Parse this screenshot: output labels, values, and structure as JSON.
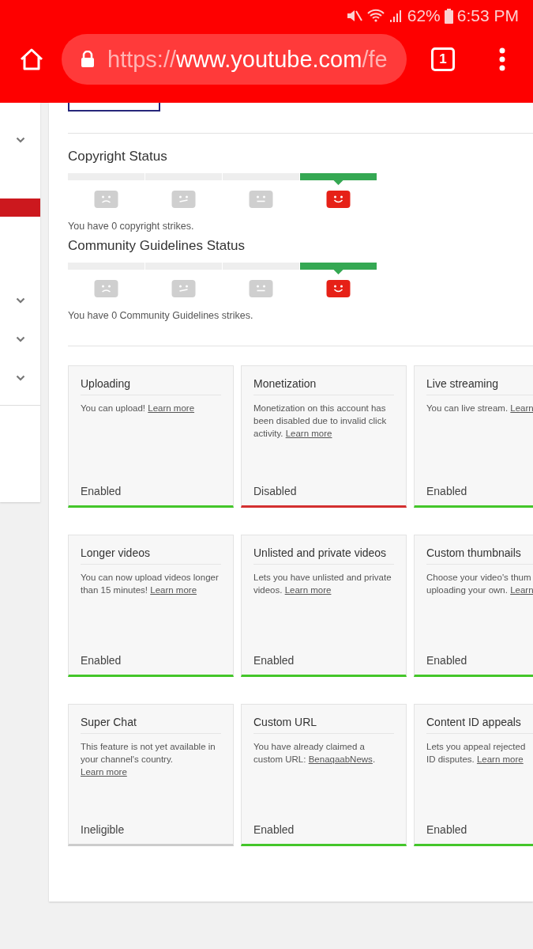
{
  "status_bar": {
    "battery": "62%",
    "time": "6:53 PM"
  },
  "browser": {
    "url_scheme": "https://",
    "url_host": "www.youtube.com",
    "url_path": "/fe",
    "tab_count": "1"
  },
  "sidebar": {
    "items": [
      {
        "expandable": true,
        "selected": false
      },
      {
        "expandable": false,
        "selected": true
      },
      {
        "expandable": true,
        "selected": false
      },
      {
        "expandable": true,
        "selected": false
      },
      {
        "expandable": true,
        "selected": false
      }
    ]
  },
  "statuses": [
    {
      "title": "Copyright Status",
      "levels": [
        {
          "kind": "sad",
          "selected": false
        },
        {
          "kind": "unsure",
          "selected": false
        },
        {
          "kind": "neutral",
          "selected": false
        },
        {
          "kind": "happy",
          "selected": true
        }
      ],
      "message": "You have 0 copyright strikes."
    },
    {
      "title": "Community Guidelines Status",
      "levels": [
        {
          "kind": "sad",
          "selected": false
        },
        {
          "kind": "unsure",
          "selected": false
        },
        {
          "kind": "neutral",
          "selected": false
        },
        {
          "kind": "happy",
          "selected": true
        }
      ],
      "message": "You have 0 Community Guidelines strikes."
    }
  ],
  "features": [
    {
      "title": "Uploading",
      "text": "You can upload! ",
      "link": "Learn more",
      "status": "Enabled",
      "kind": "enabled"
    },
    {
      "title": "Monetization",
      "text": "Monetization on this account has been disabled due to invalid click activity. ",
      "link": "Learn more",
      "status": "Disabled",
      "kind": "disabled"
    },
    {
      "title": "Live streaming",
      "text": "You can live stream. ",
      "link": "Learn",
      "status": "Enabled",
      "kind": "enabled"
    },
    {
      "title": "Longer videos",
      "text": "You can now upload videos longer than 15 minutes! ",
      "link": "Learn more",
      "status": "Enabled",
      "kind": "enabled"
    },
    {
      "title": "Unlisted and private videos",
      "text": "Lets you have unlisted and private videos. ",
      "link": "Learn more",
      "status": "Enabled",
      "kind": "enabled"
    },
    {
      "title": "Custom thumbnails",
      "text": "Choose your video's thum\nuploading your own. ",
      "link": "Learn",
      "status": "Enabled",
      "kind": "enabled"
    },
    {
      "title": "Super Chat",
      "text": "This feature is not yet available in your channel's country. ",
      "link": "Learn more",
      "status": "Ineligible",
      "kind": "ineligible"
    },
    {
      "title": "Custom URL",
      "text": "You have already claimed a custom URL: ",
      "link": "BenaqaabNews",
      "after": ".",
      "status": "Enabled",
      "kind": "enabled"
    },
    {
      "title": "Content ID appeals",
      "text": "Lets you appeal rejected\nID disputes. ",
      "link": "Learn more",
      "status": "Enabled",
      "kind": "enabled"
    }
  ]
}
